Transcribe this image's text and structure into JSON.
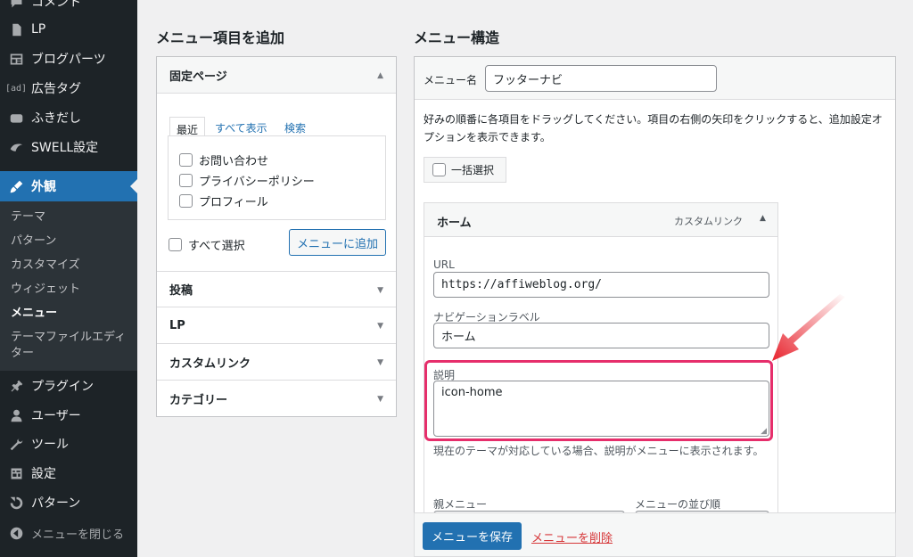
{
  "sidebar": {
    "items": [
      {
        "label": "コメント",
        "icon": "comment-icon"
      },
      {
        "label": "LP",
        "icon": "page-icon"
      },
      {
        "label": "ブログパーツ",
        "icon": "blog-parts-icon"
      },
      {
        "label": "広告タグ",
        "icon": "ad-icon",
        "icon_text": "[ad]"
      },
      {
        "label": "ふきだし",
        "icon": "speech-bubble-icon"
      },
      {
        "label": "SWELL設定",
        "icon": "swell-icon"
      },
      {
        "label": "外観",
        "icon": "appearance-icon"
      },
      {
        "label": "プラグイン",
        "icon": "plugin-icon"
      },
      {
        "label": "ユーザー",
        "icon": "user-icon"
      },
      {
        "label": "ツール",
        "icon": "tools-icon"
      },
      {
        "label": "設定",
        "icon": "settings-icon"
      },
      {
        "label": "パターン",
        "icon": "pattern-icon"
      },
      {
        "label": "メニューを閉じる",
        "icon": "collapse-icon"
      }
    ],
    "submenu": [
      {
        "label": "テーマ"
      },
      {
        "label": "パターン"
      },
      {
        "label": "カスタマイズ"
      },
      {
        "label": "ウィジェット"
      },
      {
        "label": "メニュー"
      },
      {
        "label": "テーマファイルエディター"
      }
    ]
  },
  "add_items": {
    "heading": "メニュー項目を追加",
    "fixed_page": {
      "title": "固定ページ",
      "tabs": [
        "最近",
        "すべて表示",
        "検索"
      ],
      "pages": [
        "お問い合わせ",
        "プライバシーポリシー",
        "プロフィール"
      ],
      "select_all": "すべて選択",
      "add_button": "メニューに追加"
    },
    "sections": [
      "投稿",
      "LP",
      "カスタムリンク",
      "カテゴリー"
    ]
  },
  "structure": {
    "heading": "メニュー構造",
    "menu_name_label": "メニュー名",
    "menu_name_value": "フッターナビ",
    "instructions": "好みの順番に各項目をドラッグしてください。項目の右側の矢印をクリックすると、追加設定オプションを表示できます。",
    "bulk_select": "一括選択",
    "item": {
      "title": "ホーム",
      "type": "カスタムリンク",
      "url_label": "URL",
      "url_value": "https://affiweblog.org/",
      "nav_label_label": "ナビゲーションラベル",
      "nav_label_value": "ホーム",
      "description_label": "説明",
      "description_value": "icon-home",
      "description_note": "現在のテーマが対応している場合、説明がメニューに表示されます。",
      "parent_label": "親メニュー",
      "order_label": "メニューの並び順"
    },
    "save_button": "メニューを保存",
    "delete_link": "メニューを削除"
  },
  "colors": {
    "sidebar_bg": "#1d2327",
    "accent": "#2271b1",
    "highlight": "#e62e6b",
    "arrow": "#e8252f"
  }
}
